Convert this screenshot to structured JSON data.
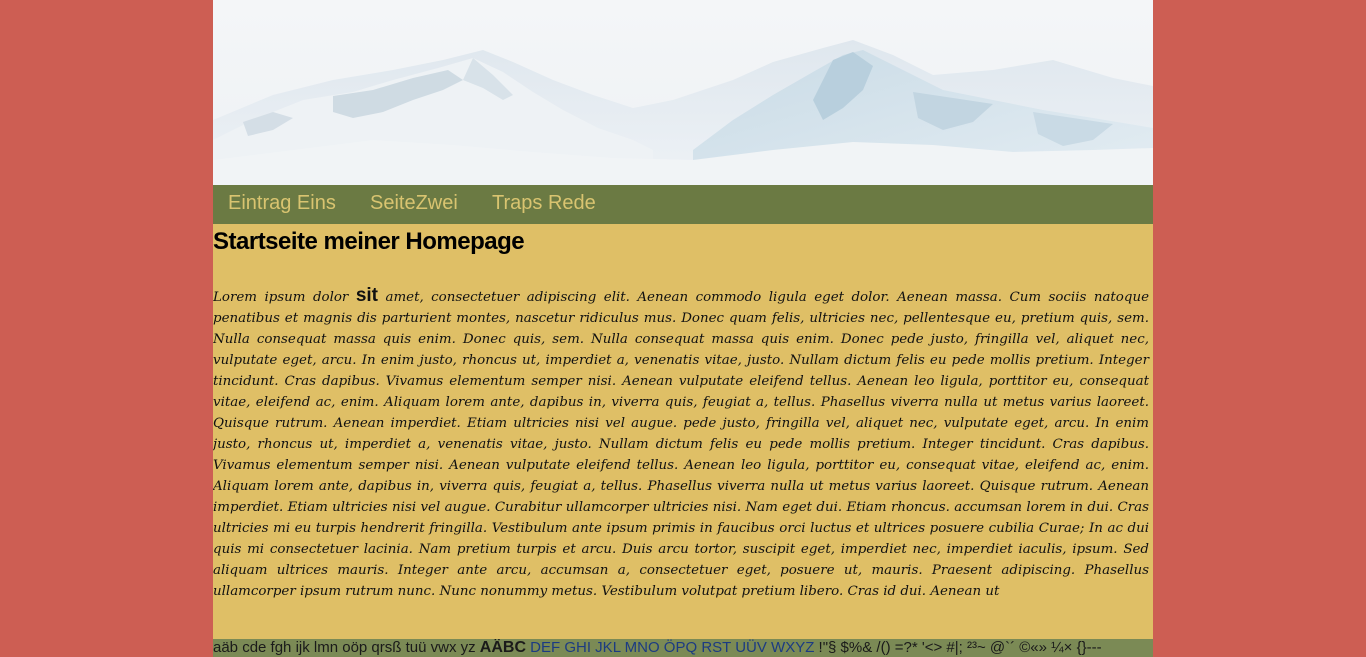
{
  "colors": {
    "page_background": "#cd5e53",
    "nav_background": "#6b7a43",
    "nav_text": "#d9c470",
    "content_background": "#dfbf66",
    "footer_background": "#7b8a55"
  },
  "banner": {
    "image": "snowy-mountains"
  },
  "nav": {
    "items": [
      {
        "label": "Eintrag Eins"
      },
      {
        "label": "SeiteZwei"
      },
      {
        "label": "Traps Rede"
      }
    ]
  },
  "content": {
    "title": "Startseite meiner Homepage",
    "text_start": "Lorem ipsum dolor ",
    "text_emph": "sit",
    "text_rest": " amet, consectetuer adipiscing elit. Aenean commodo ligula eget dolor. Aenean massa. Cum sociis natoque penatibus et magnis dis parturient montes, nascetur ridiculus mus. Donec quam felis, ultricies nec, pellentesque eu, pretium quis, sem. Nulla consequat massa quis enim. Donec quis, sem. Nulla consequat massa quis enim. Donec pede justo, fringilla vel, aliquet nec, vulputate eget, arcu. In enim justo, rhoncus ut, imperdiet a, venenatis vitae, justo. Nullam dictum felis eu pede mollis pretium. Integer tincidunt. Cras dapibus. Vivamus elementum semper nisi. Aenean vulputate eleifend tellus. Aenean leo ligula, porttitor eu, consequat vitae, eleifend ac, enim. Aliquam lorem ante, dapibus in, viverra quis, feugiat a, tellus. Phasellus viverra nulla ut metus varius laoreet. Quisque rutrum. Aenean imperdiet. Etiam ultricies nisi vel augue. pede justo, fringilla vel, aliquet nec, vulputate eget, arcu. In enim justo, rhoncus ut, imperdiet a, venenatis vitae, justo. Nullam dictum felis eu pede mollis pretium. Integer tincidunt. Cras dapibus. Vivamus elementum semper nisi. Aenean vulputate eleifend tellus. Aenean leo ligula, porttitor eu, consequat vitae, eleifend ac, enim. Aliquam lorem ante, dapibus in, viverra quis, feugiat a, tellus. Phasellus viverra nulla ut metus varius laoreet. Quisque rutrum. Aenean imperdiet. Etiam ultricies nisi vel augue. Curabitur ullamcorper ultricies nisi. Nam eget dui. Etiam rhoncus. accumsan lorem in dui. Cras ultricies mi eu turpis hendrerit fringilla. Vestibulum ante ipsum primis in faucibus orci luctus et ultrices posuere cubilia Curae; In ac dui quis mi consectetuer lacinia. Nam pretium turpis et arcu. Duis arcu tortor, suscipit eget, imperdiet nec, imperdiet iaculis, ipsum. Sed aliquam ultrices mauris. Integer ante arcu, accumsan a, consectetuer eget, posuere ut, mauris. Praesent adipiscing. Phasellus ullamcorper ipsum rutrum nunc. Nunc nonummy metus. Vestibulum volutpat pretium libero. Cras id dui. Aenean ut"
  },
  "footer": {
    "part1": "aäb cde fgh ijk lmn oöp qrsß tuü vwx yz ",
    "part2": "AÄBC",
    "part3": " DEF GHI JKL MNO ÖPQ RST UÜV WXYZ ",
    "part4": "!\"§ $%& /() =?* '<> #|; ²³~ @`´ ©«» ¼× {}---"
  }
}
